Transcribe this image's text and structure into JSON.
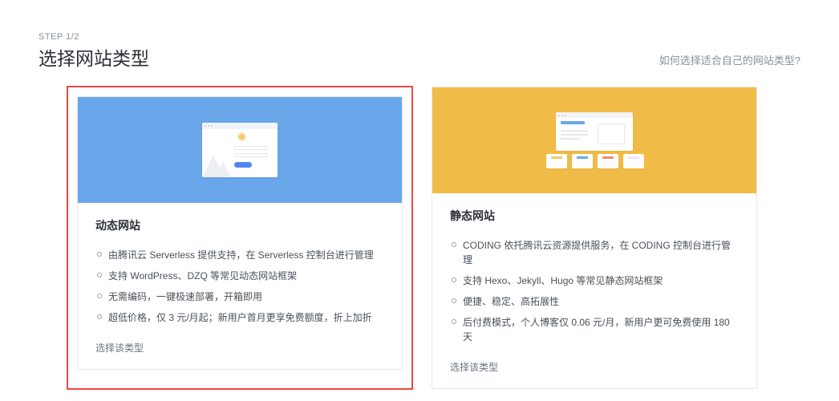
{
  "header": {
    "step": "STEP 1/2",
    "title": "选择网站类型",
    "help": "如何选择适合自己的网站类型?"
  },
  "cards": [
    {
      "title": "动态网站",
      "features": [
        "由腾讯云 Serverless 提供支持，在 Serverless 控制台进行管理",
        "支持 WordPress、DZQ 等常见动态网站框架",
        "无需编码，一键极速部署，开箱即用",
        "超低价格，仅 3 元/月起；新用户首月更享免费额度，折上加折"
      ],
      "action": "选择该类型",
      "selected": true
    },
    {
      "title": "静态网站",
      "features": [
        "CODING 依托腾讯云资源提供服务，在 CODING 控制台进行管理",
        "支持 Hexo、Jekyll、Hugo 等常见静态网站框架",
        "便捷、稳定、高拓展性",
        "后付费模式，个人博客仅 0.06 元/月，新用户更可免费使用 180 天"
      ],
      "action": "选择该类型",
      "selected": false
    }
  ]
}
